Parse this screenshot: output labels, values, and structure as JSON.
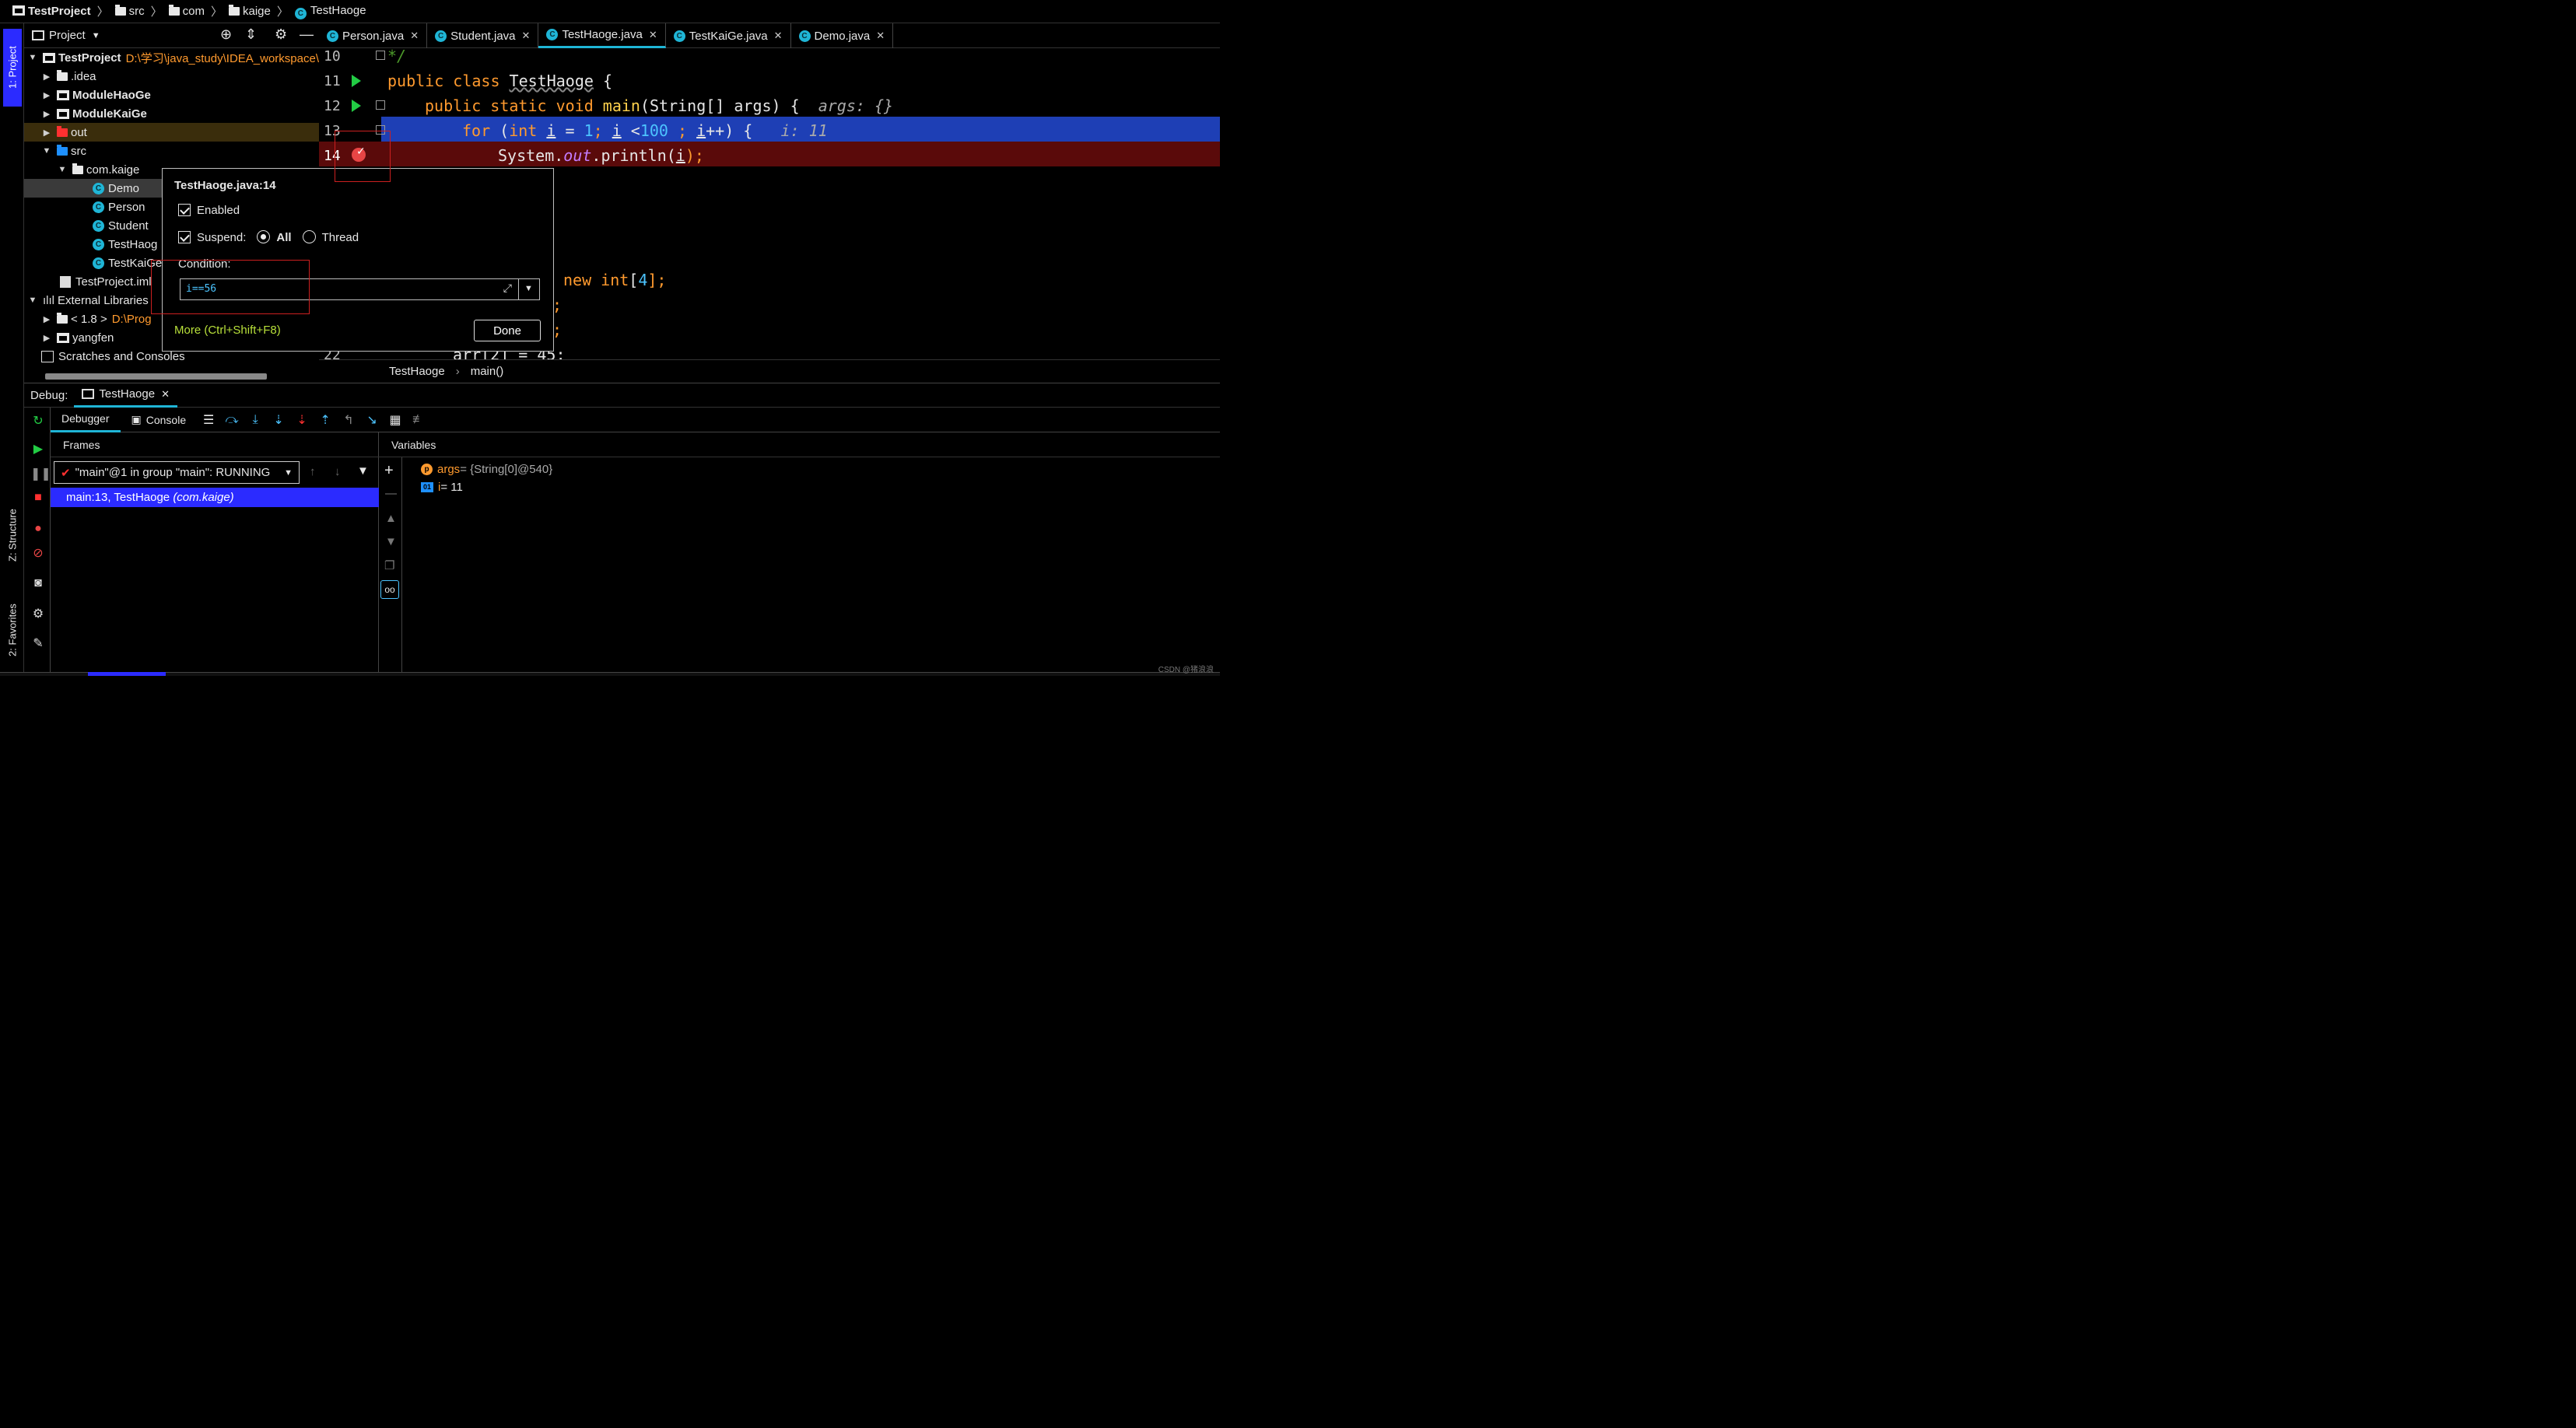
{
  "breadcrumb": {
    "project": "TestProject",
    "items": [
      "src",
      "com",
      "kaige"
    ],
    "current": "TestHaoge"
  },
  "left_strip": {
    "project_tab": "1: Project",
    "structure_tab": "Z: Structure",
    "favorites_tab": "2: Favorites"
  },
  "project_panel": {
    "title": "Project",
    "tree": [
      {
        "label": "TestProject",
        "path": "D:\\学习\\java_study\\IDEA_workspace\\"
      },
      {
        "label": ".idea"
      },
      {
        "label": "ModuleHaoGe"
      },
      {
        "label": "ModuleKaiGe"
      },
      {
        "label": "out"
      },
      {
        "label": "src"
      },
      {
        "label": "com.kaige"
      },
      {
        "label": "Demo"
      },
      {
        "label": "Person"
      },
      {
        "label": "Student"
      },
      {
        "label": "TestHaog"
      },
      {
        "label": "TestKaiGe"
      },
      {
        "label": "TestProject.iml"
      },
      {
        "label": "External Libraries"
      },
      {
        "label": "< 1.8 >",
        "path": "D:\\Prog"
      },
      {
        "label": "yangfen"
      },
      {
        "label": "Scratches and Consoles"
      }
    ]
  },
  "editor_tabs": [
    "Person.java",
    "Student.java",
    "TestHaoge.java",
    "TestKaiGe.java",
    "Demo.java"
  ],
  "editor": {
    "lines": [
      "10",
      "11",
      "12",
      "13",
      "14",
      "22"
    ],
    "comment_end": "*/",
    "l11": {
      "kw": "public class ",
      "name": "TestHaoge",
      "rest": " {"
    },
    "l12": {
      "kw": "public static void ",
      "fn": "main",
      "rest": "(String[] args) {",
      "hint": "args: {}"
    },
    "l13": {
      "kw1": "for ",
      "p1": "(",
      "kw2": "int ",
      "v": "i",
      "eq": " = ",
      "n1": "1",
      "semi": "; ",
      "v2": "i",
      "lt": " <",
      "n2": "100",
      "sp": " ; ",
      "v3": "i",
      "inc": "++) {",
      "hint": "i: 11"
    },
    "l14": {
      "sys": "System.",
      "out": "out",
      "print": ".println(",
      "v": "i",
      "end": ");"
    },
    "l18": {
      "kw": "new int",
      "p": "[",
      "n": "4",
      "end": "];"
    },
    "l19": ";",
    "l20": ";",
    "l22": "arr[2] = 45;"
  },
  "editor_crumb": {
    "cls": "TestHaoge",
    "method": "main()"
  },
  "popup": {
    "title": "TestHaoge.java:14",
    "enabled": "Enabled",
    "suspend": "Suspend:",
    "all": "All",
    "thread": "Thread",
    "condition_label": "Condition:",
    "condition_value": "i==56",
    "more": "More (Ctrl+Shift+F8)",
    "done": "Done"
  },
  "debug": {
    "label": "Debug:",
    "session": "TestHaoge",
    "debugger_tab": "Debugger",
    "console_tab": "Console",
    "frames_title": "Frames",
    "variables_title": "Variables",
    "thread": "\"main\"@1 in group \"main\": RUNNING",
    "frame": "main:13, TestHaoge",
    "frame_pkg": "(com.kaige)",
    "vars": [
      {
        "name": "args",
        "value": " = {String[0]@540}"
      },
      {
        "name": "i",
        "value": " = 11"
      }
    ]
  },
  "watermark": "CSDN @猪浪浪",
  "colors": {
    "accent": "#1fb5d6",
    "selection": "#2b2bff",
    "exec_line": "#1e3fb5",
    "bp_line": "#5a0a0a"
  }
}
